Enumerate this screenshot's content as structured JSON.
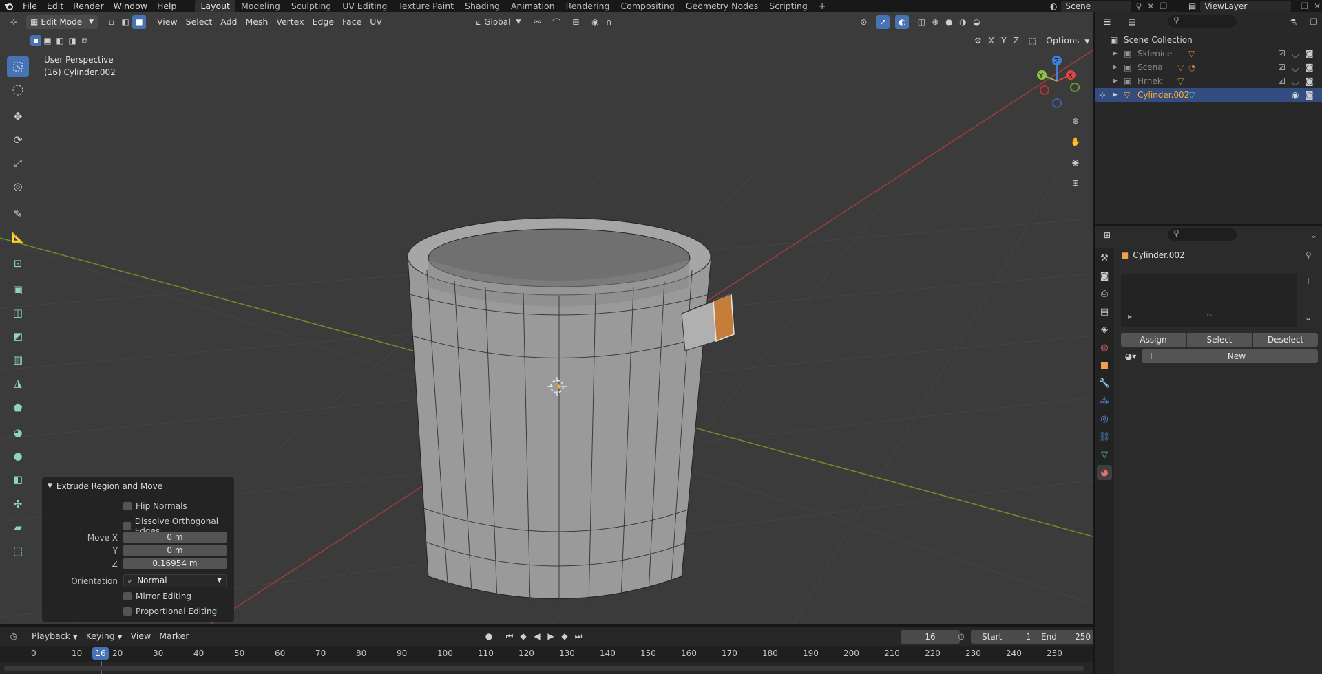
{
  "topbar": {
    "menus": [
      "File",
      "Edit",
      "Render",
      "Window",
      "Help"
    ],
    "workspaces": [
      "Layout",
      "Modeling",
      "Sculpting",
      "UV Editing",
      "Texture Paint",
      "Shading",
      "Animation",
      "Rendering",
      "Compositing",
      "Geometry Nodes",
      "Scripting",
      "+"
    ],
    "scene_name": "Scene",
    "view_layer": "ViewLayer"
  },
  "viewport_header": {
    "mode": "Edit Mode",
    "menus": [
      "View",
      "Select",
      "Add",
      "Mesh",
      "Vertex",
      "Edge",
      "Face",
      "UV"
    ],
    "orientation": "Global",
    "axes": [
      "X",
      "Y",
      "Z"
    ],
    "options_label": "Options"
  },
  "viewport": {
    "perspective": "User Perspective",
    "object_info": "(16) Cylinder.002",
    "gizmo_axes": [
      "X",
      "Y",
      "Z"
    ]
  },
  "operator_panel": {
    "title": "Extrude Region and Move",
    "flip_normals": "Flip Normals",
    "dissolve_edges": "Dissolve Orthogonal Edges",
    "move_x_label": "Move X",
    "move_x": "0 m",
    "move_y_label": "Y",
    "move_y": "0 m",
    "move_z_label": "Z",
    "move_z": "0.16954 m",
    "orientation_label": "Orientation",
    "orientation_value": "Normal",
    "mirror_editing": "Mirror Editing",
    "proportional_editing": "Proportional Editing"
  },
  "timeline": {
    "menus": [
      "Playback",
      "Keying",
      "View",
      "Marker"
    ],
    "current_frame": "16",
    "start_label": "Start",
    "start": "1",
    "end_label": "End",
    "end": "250",
    "ruler": [
      "0",
      "10",
      "20",
      "30",
      "40",
      "50",
      "60",
      "70",
      "80",
      "90",
      "100",
      "110",
      "120",
      "130",
      "140",
      "150",
      "160",
      "170",
      "180",
      "190",
      "200",
      "210",
      "220",
      "230",
      "240",
      "250"
    ],
    "playhead_label": "16"
  },
  "outliner": {
    "root": "Scene Collection",
    "items": [
      {
        "label": "Sklenice"
      },
      {
        "label": "Scena"
      },
      {
        "label": "Hrnek"
      },
      {
        "label": "Cylinder.002"
      }
    ]
  },
  "properties": {
    "object_name": "Cylinder.002",
    "assign": "Assign",
    "select": "Select",
    "deselect": "Deselect",
    "new": "New"
  },
  "colors": {
    "accent": "#4772b3",
    "selected_text": "#ffaf29",
    "x_axis": "#e04646",
    "y_axis": "#8bc34a",
    "z_axis": "#3f7fd6"
  }
}
